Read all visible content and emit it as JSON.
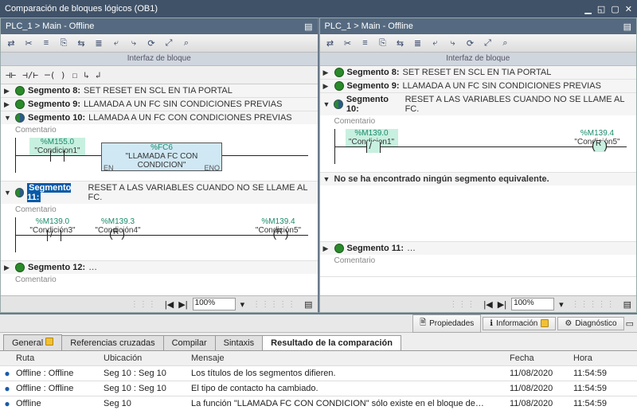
{
  "title": "Comparación de bloques lógicos (OB1)",
  "pane_header": "PLC_1 > Main - Offline",
  "iface_label": "Interfaz de bloque",
  "zoom": "100%",
  "no_equiv": "No se ha encontrado ningún segmento equivalente.",
  "comment_label": "Comentario",
  "prop_tabs": {
    "propiedades": "Propiedades",
    "informacion": "Información",
    "diagnostico": "Diagnóstico"
  },
  "tabs": {
    "general": "General",
    "ref": "Referencias cruzadas",
    "compilar": "Compilar",
    "sintaxis": "Sintaxis",
    "resultado": "Resultado de la comparación"
  },
  "grid_head": {
    "ruta": "Ruta",
    "ubic": "Ubicación",
    "msg": "Mensaje",
    "fecha": "Fecha",
    "hora": "Hora"
  },
  "rows": [
    {
      "ruta": "Offline : Offline",
      "ubic": "Seg 10 : Seg 10",
      "msg": "Los títulos de los segmentos difieren.",
      "fecha": "11/08/2020",
      "hora": "11:54:59"
    },
    {
      "ruta": "Offline : Offline",
      "ubic": "Seg 10 : Seg 10",
      "msg": "El tipo de contacto ha cambiado.",
      "fecha": "11/08/2020",
      "hora": "11:54:59"
    },
    {
      "ruta": "Offline",
      "ubic": "Seg 10",
      "msg": "La función \"LLAMADA FC CON CONDICION\" sólo existe en el bloque de…",
      "fecha": "11/08/2020",
      "hora": "11:54:59"
    }
  ],
  "left": {
    "seg8": {
      "num": "Segmento 8:",
      "title": "SET RESET EN SCL EN TIA PORTAL"
    },
    "seg9": {
      "num": "Segmento 9:",
      "title": "LLAMADA A UN FC SIN CONDICIONES PREVIAS"
    },
    "seg10": {
      "num": "Segmento 10:",
      "title": "LLAMADA A UN FC CON CONDICIONES PREVIAS",
      "tag1": "%M155.0",
      "name1": "\"Condicion1\"",
      "fc_tag": "%FC6",
      "fc_name": "\"LLAMADA FC CON CONDICION\"",
      "en": "EN",
      "eno": "ENO"
    },
    "seg11": {
      "num": "Segmento 11:",
      "title": "RESET A LAS VARIABLES CUANDO NO SE LLAME AL FC.",
      "t1": "%M139.0",
      "n1": "\"Condición3\"",
      "t2": "%M139.3",
      "n2": "\"Condición4\"",
      "t3": "%M139.4",
      "n3": "\"Condición5\"",
      "coil": "R"
    },
    "seg12": {
      "num": "Segmento 12:",
      "title": "…"
    }
  },
  "right": {
    "seg8": {
      "num": "Segmento 8:",
      "title": "SET RESET EN SCL EN TIA PORTAL"
    },
    "seg9": {
      "num": "Segmento 9:",
      "title": "LLAMADA A UN FC SIN CONDICIONES PREVIAS"
    },
    "seg10": {
      "num": "Segmento 10:",
      "title": "RESET A LAS VARIABLES CUANDO NO SE LLAME AL FC.",
      "t1": "%M139.0",
      "n1": "\"Condicion1\"",
      "t2": "%M139.4",
      "n2": "\"Condición5\"",
      "coil": "R"
    },
    "seg11": {
      "num": "Segmento 11:",
      "title": "…"
    }
  }
}
